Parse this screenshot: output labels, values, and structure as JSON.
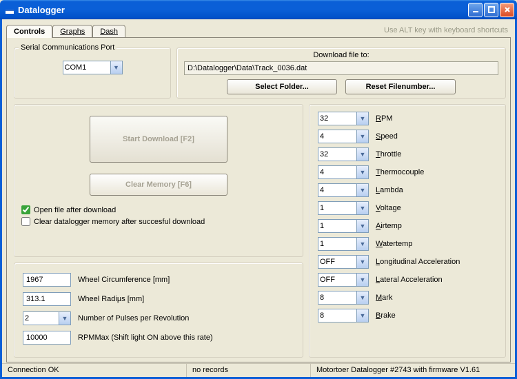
{
  "window": {
    "title": "Datalogger"
  },
  "tabs": {
    "controls": "Controls",
    "graphs": "Graphs",
    "dash": "Dash",
    "hint": "Use ALT key with keyboard shortcuts"
  },
  "serial": {
    "label": "Serial Communications Port",
    "value": "COM1"
  },
  "download": {
    "caption": "Download file to:",
    "path": "D:\\Datalogger\\Data\\Track_0036.dat",
    "select_folder": "Select Folder...",
    "reset_filenum": "Reset Filenumber..."
  },
  "actions": {
    "start_download": "Start Download [F2]",
    "clear_memory": "Clear Memory [F6]",
    "open_after": "Open file after download",
    "clear_after": "Clear datalogger memory after succesful download"
  },
  "wheel": {
    "circumference": {
      "value": "1967",
      "label": "Wheel Circumference [mm]"
    },
    "radius": {
      "value": "313.1",
      "label": "Wheel Radiµs [mm]"
    },
    "pulses": {
      "value": "2",
      "label": "Number of Pulses per Revolution"
    },
    "rpmmax": {
      "value": "10000",
      "label": "RPMMax (Shift light ON above this rate)"
    }
  },
  "channels": [
    {
      "value": "32",
      "label": "RPM"
    },
    {
      "value": "4",
      "label": "Speed"
    },
    {
      "value": "32",
      "label": "Throttle"
    },
    {
      "value": "4",
      "label": "Thermocouple"
    },
    {
      "value": "4",
      "label": "Lambda"
    },
    {
      "value": "1",
      "label": "Voltage"
    },
    {
      "value": "1",
      "label": "Airtemp"
    },
    {
      "value": "1",
      "label": "Watertemp"
    },
    {
      "value": "OFF",
      "label": "Longitudinal Acceleration"
    },
    {
      "value": "OFF",
      "label": "Lateral Acceleration"
    },
    {
      "value": "8",
      "label": "Mark"
    },
    {
      "value": "8",
      "label": "Brake"
    }
  ],
  "status": {
    "connection": "Connection OK",
    "records": "no records",
    "device": "Motortoer Datalogger #2743 with firmware V1.61"
  }
}
